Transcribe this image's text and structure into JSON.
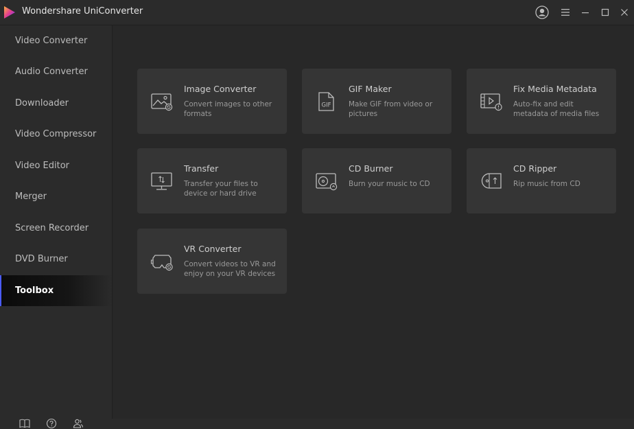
{
  "app": {
    "title": "Wondershare UniConverter"
  },
  "sidebar": {
    "items": [
      {
        "label": "Video Converter"
      },
      {
        "label": "Audio Converter"
      },
      {
        "label": "Downloader"
      },
      {
        "label": "Video Compressor"
      },
      {
        "label": "Video Editor"
      },
      {
        "label": "Merger"
      },
      {
        "label": "Screen Recorder"
      },
      {
        "label": "DVD Burner"
      },
      {
        "label": "Toolbox",
        "active": true
      }
    ],
    "bottom_icons": [
      "book-icon",
      "help-icon",
      "account-icon"
    ]
  },
  "toolbox": {
    "cards": [
      {
        "title": "Image Converter",
        "desc": "Convert images to other formats",
        "icon": "image-icon"
      },
      {
        "title": "GIF Maker",
        "desc": "Make GIF from video or pictures",
        "icon": "gif-icon"
      },
      {
        "title": "Fix Media Metadata",
        "desc": "Auto-fix and edit metadata of media files",
        "icon": "metadata-icon"
      },
      {
        "title": "Transfer",
        "desc": "Transfer your files to device or hard drive",
        "icon": "transfer-icon"
      },
      {
        "title": "CD Burner",
        "desc": "Burn your music to CD",
        "icon": "cd-burner-icon"
      },
      {
        "title": "CD Ripper",
        "desc": "Rip music from CD",
        "icon": "cd-ripper-icon"
      },
      {
        "title": "VR Converter",
        "desc": "Convert videos to VR and enjoy on your VR devices",
        "icon": "vr-icon"
      }
    ]
  },
  "colors": {
    "accent": "#4a5bff",
    "background": "#2b2b2b",
    "card": "#353535"
  }
}
